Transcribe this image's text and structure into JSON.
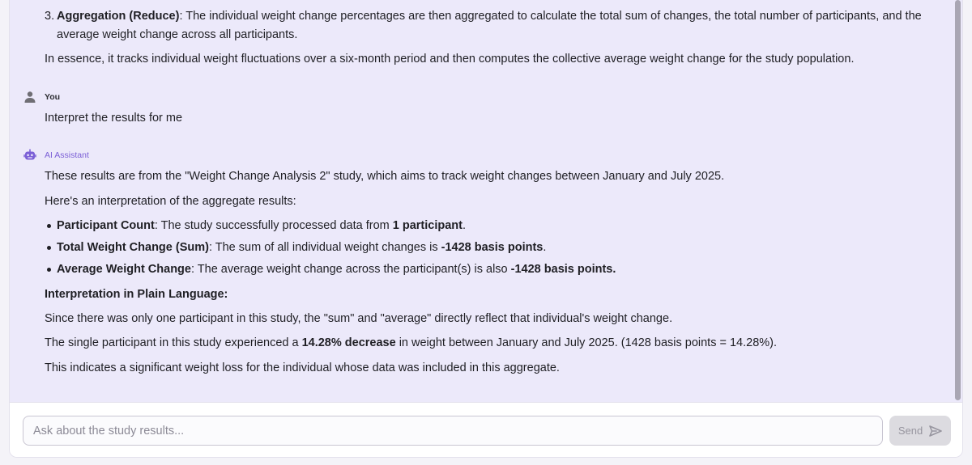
{
  "conversation": {
    "prev_item": {
      "number": "3.",
      "bold": "Aggregation (Reduce)",
      "text_line1": ": The individual weight change percentages are then aggregated to calculate the total sum of changes, the total number of participants, and the",
      "text_line2": "average weight change across all participants."
    },
    "prev_summary": "In essence, it tracks individual weight fluctuations over a six-month period and then computes the collective average weight change for the study population.",
    "user": {
      "label": "You",
      "icon": "person-icon",
      "message": "Interpret the results for me"
    },
    "assistant": {
      "label": "AI Assistant",
      "icon": "robot-icon",
      "accent_color": "#7b5fd6",
      "intro": "These results are from the \"Weight Change Analysis 2\" study, which aims to track weight changes between January and July 2025.",
      "lead": "Here's an interpretation of the aggregate results:",
      "bullets": [
        {
          "bold": "Participant Count",
          "pre": ": The study successfully processed data from ",
          "value": "1 participant",
          "post": "."
        },
        {
          "bold": "Total Weight Change (Sum)",
          "pre": ": The sum of all individual weight changes is ",
          "value": "-1428 basis points",
          "post": "."
        },
        {
          "bold": "Average Weight Change",
          "pre": ": The average weight change across the participant(s) is also ",
          "value": "-1428 basis points.",
          "post": ""
        }
      ],
      "plain_heading": "Interpretation in Plain Language:",
      "p1": "Since there was only one participant in this study, the \"sum\" and \"average\" directly reflect that individual's weight change.",
      "p2_pre": "The single participant in this study experienced a ",
      "p2_bold": "14.28% decrease",
      "p2_post": " in weight between January and July 2025. (1428 basis points = 14.28%).",
      "p3": "This indicates a significant weight loss for the individual whose data was included in this aggregate."
    }
  },
  "composer": {
    "placeholder": "Ask about the study results...",
    "value": "",
    "send_label": "Send",
    "send_icon": "send-icon"
  }
}
